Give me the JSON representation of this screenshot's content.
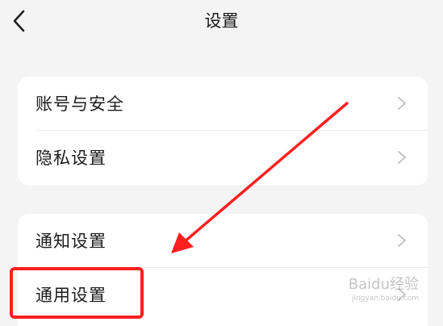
{
  "header": {
    "title": "设置"
  },
  "groups": [
    {
      "items": [
        {
          "label": "账号与安全"
        },
        {
          "label": "隐私设置"
        }
      ]
    },
    {
      "items": [
        {
          "label": "通知设置"
        },
        {
          "label": "通用设置"
        }
      ]
    }
  ],
  "annotation": {
    "highlight_color": "#ff1f1f",
    "highlighted_item": "通用设置"
  },
  "watermark": {
    "text": "Baidu经验",
    "sub": "jingyan.baidu.com"
  },
  "colors": {
    "background": "#f4f4f4",
    "card": "#ffffff",
    "chevron": "#c4c4c4",
    "arrow": "#ff1f1f"
  }
}
